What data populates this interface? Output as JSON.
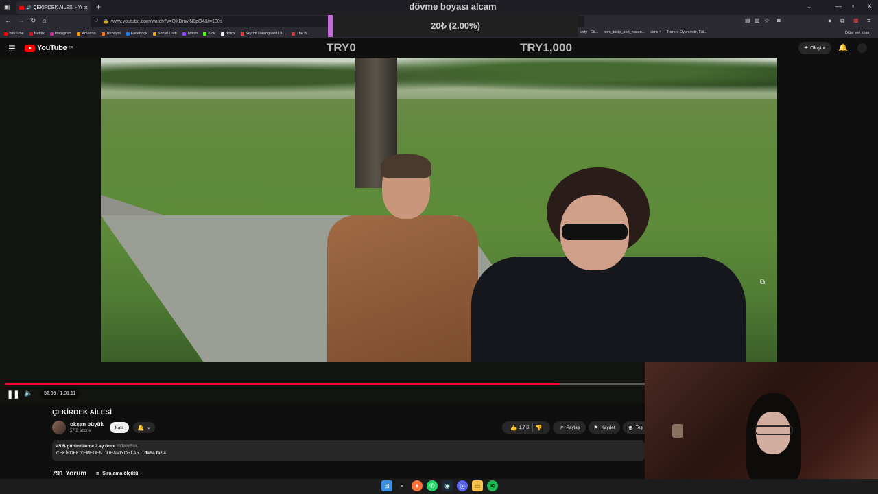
{
  "browser": {
    "tab_title": "ÇEKİRDEK AİLESİ - YouTube",
    "tab_close": "×",
    "new_tab": "+",
    "url": "www.youtube.com/watch?v=QXDnwiN8pO4&t=180s",
    "bookmarks": [
      {
        "label": "YouTube",
        "color": "#ff0000"
      },
      {
        "label": "Netflix",
        "color": "#e50914"
      },
      {
        "label": "Instagram",
        "color": "#d6249f"
      },
      {
        "label": "Amazon",
        "color": "#ff9900"
      },
      {
        "label": "Trendyol",
        "color": "#f27a1a"
      },
      {
        "label": "Facebook",
        "color": "#1877f2"
      },
      {
        "label": "Social Club",
        "color": "#f5a623"
      },
      {
        "label": "Twitch",
        "color": "#9146ff"
      },
      {
        "label": "Kick",
        "color": "#53fc18"
      },
      {
        "label": "Botrix",
        "color": "#ffffff"
      },
      {
        "label": "Skyrim Dawnguard DL...",
        "color": "#e53935"
      },
      {
        "label": "The B...",
        "color": "#e53935"
      }
    ],
    "bookmarks_right": [
      {
        "label": "asty - Ek...",
        "color": "#888888"
      },
      {
        "label": "borc_takip_afet_hasan...",
        "color": "#4caf50"
      },
      {
        "label": "sims 4",
        "color": "#cccccc"
      },
      {
        "label": "Torrent Oyun indir, Ful...",
        "color": "#e53935"
      }
    ],
    "other_bookmarks": "Diğer yer imleri"
  },
  "stream_overlay": {
    "donation_message": "dövme boyası alcam",
    "donation_amount": "20₺ (2.00%)",
    "goal_current": "TRY0",
    "goal_target": "TRY1,000",
    "accent_color": "#c26cd6"
  },
  "youtube": {
    "logo_text": "YouTube",
    "logo_region": "TR",
    "create_label": "Oluştur",
    "player": {
      "time_display": "52:59 / 1:01:11",
      "progress_fraction": 0.866
    },
    "video": {
      "title": "ÇEKİRDEK AİLESİ",
      "channel_name": "okşan büyük",
      "subscribers": "57 B abone",
      "join_label": "Katıl",
      "likes": "1,7 B",
      "share_label": "Paylaş",
      "save_label": "Kaydet",
      "thanks_label": "Teş",
      "views_date": "45 B görüntüleme  2 ay önce",
      "location_tag": "İSTANBUL",
      "description": "ÇEKİRDEK YEMEDEN DURAMIYORLAR ",
      "more_label": "...daha fazla"
    },
    "comments": {
      "count_label": "791 Yorum",
      "sort_label": "Sıralama ölçütü:"
    }
  },
  "colors": {
    "youtube_red": "#ff0000",
    "progress_red": "#ff0033",
    "page_bg": "#0f0f0f"
  }
}
